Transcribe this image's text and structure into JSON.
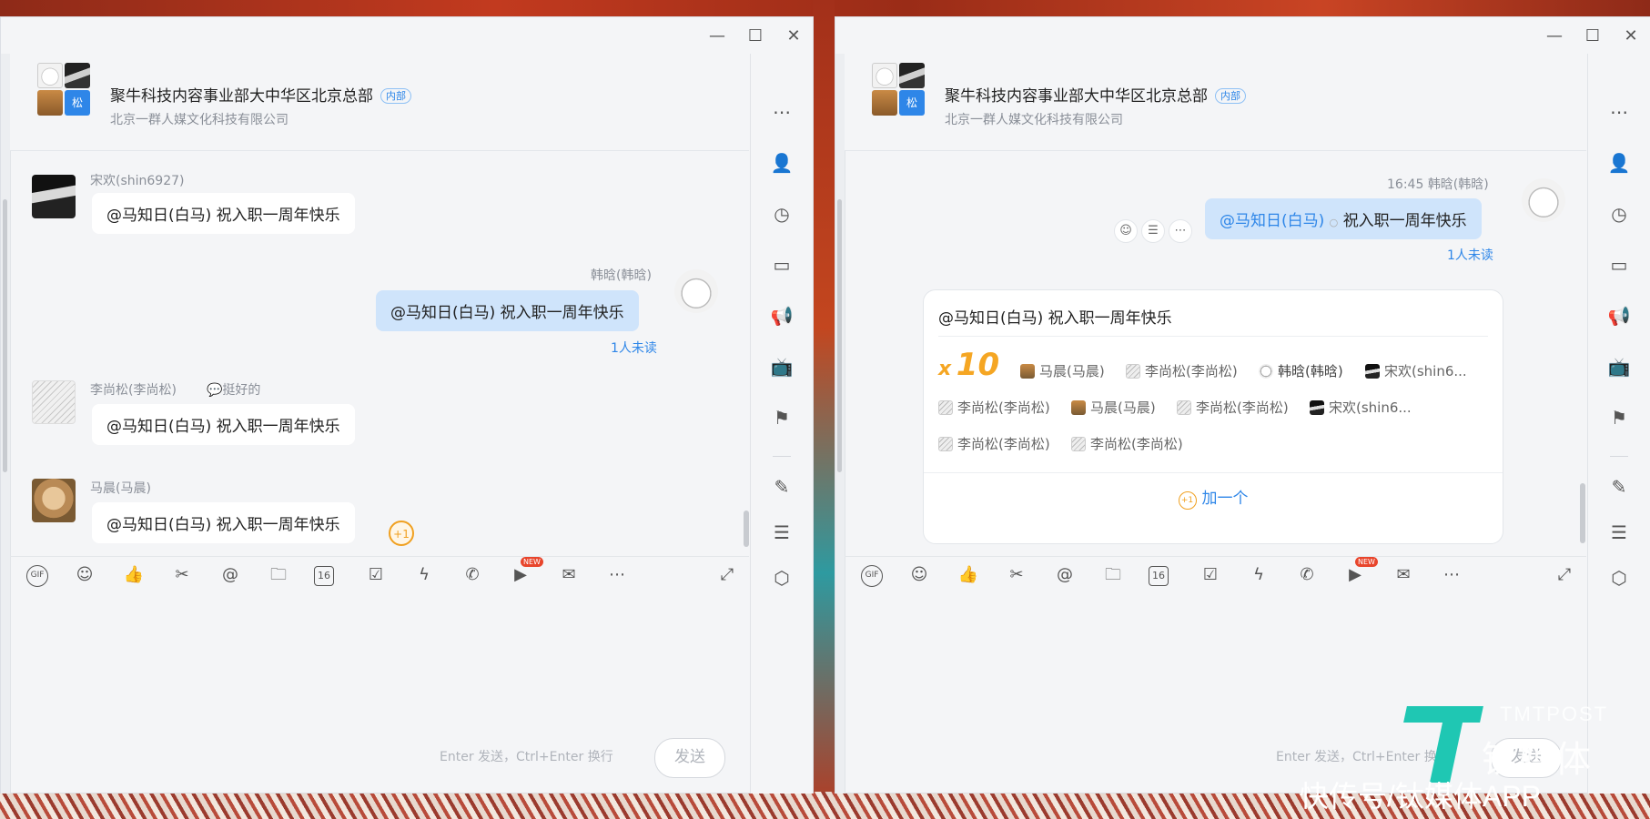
{
  "window_controls": {
    "minimize": "—",
    "maximize": "☐",
    "close": "✕"
  },
  "group": {
    "title": "聚牛科技内容事业部大中华区北京总部",
    "tag": "内部",
    "subtitle": "北京一群人媒文化科技有限公司",
    "avatar_badge": "松"
  },
  "left": {
    "messages": [
      {
        "sender": "宋欢(shin6927)",
        "text": "@马知日(白马) 祝入职一周年快乐"
      },
      {
        "sender": "韩晗(韩晗)",
        "text": "@马知日(白马) 祝入职一周年快乐",
        "status": "1人未读"
      },
      {
        "sender": "李尚松(李尚松)",
        "quote": "💬挺好的",
        "text": "@马知日(白马) 祝入职一周年快乐"
      },
      {
        "sender": "马晨(马晨)",
        "text": "@马知日(白马) 祝入职一周年快乐",
        "plus": "+1"
      }
    ]
  },
  "right": {
    "time": "16:45",
    "sender": "韩晗(韩晗)",
    "mention": "@马知日(白马)",
    "text": "祝入职一周年快乐",
    "status": "1人未读",
    "card": {
      "title": "@马知日(白马) 祝入职一周年快乐",
      "x": "x",
      "count": "10",
      "people": [
        "马晨(马晨)",
        "李尚松(李尚松)",
        "韩晗(韩晗)",
        "宋欢(shin6...",
        "李尚松(李尚松)",
        "马晨(马晨)",
        "李尚松(李尚松)",
        "宋欢(shin6...",
        "李尚松(李尚松)",
        "李尚松(李尚松)"
      ],
      "add": "加一个",
      "add_icon": "+1"
    },
    "react_buttons": [
      "☺",
      "☰",
      "⋯"
    ]
  },
  "toolbar": {
    "gif": "GIF",
    "new": "NEW",
    "calendar": "16"
  },
  "composer": {
    "hint": "Enter 发送，Ctrl+Enter 换行",
    "send": "发送"
  },
  "watermark": {
    "brand_en": "TMTPOST",
    "brand_cn": "钛媒体",
    "tagline": "快传号/钛媒体APP"
  },
  "colors": {
    "accent": "#2e86e8",
    "bubble_me": "#cfe4fb",
    "reaction": "#f5a623",
    "watermark": "#1fc7b3"
  }
}
